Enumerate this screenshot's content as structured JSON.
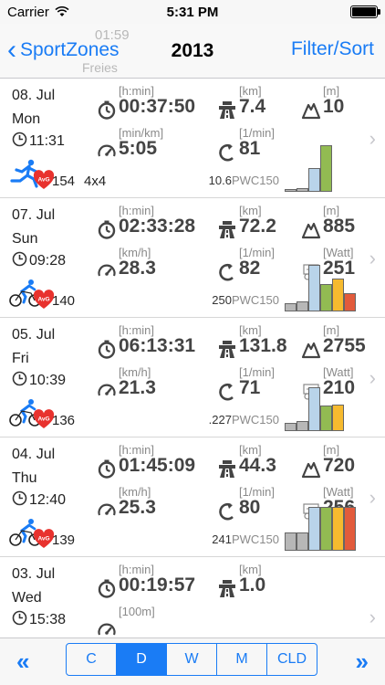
{
  "status": {
    "carrier": "Carrier",
    "time": "5:31 PM"
  },
  "nav": {
    "back_label": "SportZones",
    "title": "2013",
    "right_label": "Filter/Sort"
  },
  "ghost": {
    "left_value": "01:59",
    "sub": "Freies"
  },
  "colors": {
    "accent": "#1a7cf5",
    "bar_gray": "#b7b7b7",
    "bar_blue": "#b9d4ea",
    "bar_green": "#92bb52",
    "bar_yellow": "#f6ba2f",
    "bar_red": "#e25b3c"
  },
  "rows": [
    {
      "date": "08. Jul",
      "day": "Mon",
      "start": "11:31",
      "sport": "running-icon",
      "hr": "154",
      "gear": "4x4",
      "duration": {
        "unit": "[h:min]",
        "value": "00:37:50"
      },
      "distance": {
        "unit": "[km]",
        "value": "7.4"
      },
      "ascent": {
        "unit": "[m]",
        "value": "10"
      },
      "speed": {
        "unit": "[min/km]",
        "value": "5:05"
      },
      "cadence": {
        "unit": "[1/min]",
        "value": "81"
      },
      "pwc": "10.6",
      "pwc_label": "PWC150",
      "zones": [
        0.05,
        0.06,
        0.4,
        0.78
      ]
    },
    {
      "date": "07. Jul",
      "day": "Sun",
      "start": "09:28",
      "sport": "cycling-icon",
      "hr": "140",
      "duration": {
        "unit": "[h:min]",
        "value": "02:33:28"
      },
      "distance": {
        "unit": "[km]",
        "value": "72.2"
      },
      "ascent": {
        "unit": "[m]",
        "value": "885"
      },
      "speed": {
        "unit": "[km/h]",
        "value": "28.3"
      },
      "cadence": {
        "unit": "[1/min]",
        "value": "82"
      },
      "power": {
        "unit": "[Watt]",
        "value": "251"
      },
      "pwc": "250",
      "pwc_label": "PWC150",
      "zones": [
        0.14,
        0.16,
        0.78,
        0.45,
        0.55,
        0.3
      ]
    },
    {
      "date": "05. Jul",
      "day": "Fri",
      "start": "10:39",
      "sport": "cycling-icon",
      "hr": "136",
      "duration": {
        "unit": "[h:min]",
        "value": "06:13:31"
      },
      "distance": {
        "unit": "[km]",
        "value": "131.8"
      },
      "ascent": {
        "unit": "[m]",
        "value": "2755"
      },
      "speed": {
        "unit": "[km/h]",
        "value": "21.3"
      },
      "cadence": {
        "unit": "[1/min]",
        "value": "71"
      },
      "power": {
        "unit": "[Watt]",
        "value": "210"
      },
      "pwc": ".227",
      "pwc_label": "PWC150",
      "zones": [
        0.14,
        0.16,
        0.72,
        0.42,
        0.44
      ]
    },
    {
      "date": "04. Jul",
      "day": "Thu",
      "start": "12:40",
      "sport": "cycling-icon",
      "hr": "139",
      "duration": {
        "unit": "[h:min]",
        "value": "01:45:09"
      },
      "distance": {
        "unit": "[km]",
        "value": "44.3"
      },
      "ascent": {
        "unit": "[m]",
        "value": "720"
      },
      "speed": {
        "unit": "[km/h]",
        "value": "25.3"
      },
      "cadence": {
        "unit": "[1/min]",
        "value": "80"
      },
      "power": {
        "unit": "[Watt]",
        "value": "256"
      },
      "pwc": "241",
      "pwc_label": "PWC150",
      "zones": [
        0.3,
        0.3,
        0.72,
        0.72,
        0.72,
        0.72
      ]
    },
    {
      "date": "03. Jul",
      "day": "Wed",
      "start": "15:38",
      "sport": "",
      "duration": {
        "unit": "[h:min]",
        "value": "00:19:57"
      },
      "distance": {
        "unit": "[km]",
        "value": "1.0"
      },
      "speed": {
        "unit": "[100m]"
      }
    }
  ],
  "toolbar": {
    "segments": [
      "C",
      "D",
      "W",
      "M",
      "CLD"
    ],
    "selected": "D"
  }
}
